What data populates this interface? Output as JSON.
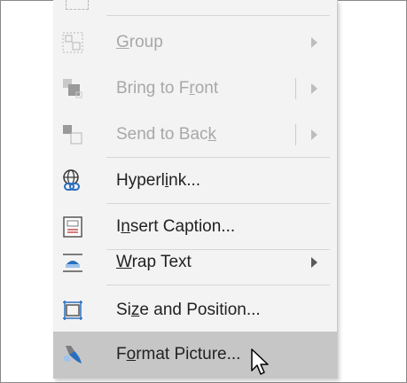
{
  "menu": {
    "items": [
      {
        "pre": "",
        "ul": "G",
        "post": "roup",
        "disabled": true,
        "submenu": true,
        "split": false,
        "icon": "group-icon"
      },
      {
        "pre": "Bring to F",
        "ul": "r",
        "post": "ont",
        "disabled": true,
        "submenu": true,
        "split": true,
        "icon": "bring-to-front-icon"
      },
      {
        "pre": "Send to Bac",
        "ul": "k",
        "post": "",
        "disabled": true,
        "submenu": true,
        "split": true,
        "icon": "send-to-back-icon"
      },
      {
        "pre": "Hyperl",
        "ul": "i",
        "post": "nk...",
        "disabled": false,
        "submenu": false,
        "split": false,
        "icon": "hyperlink-icon"
      },
      {
        "pre": "I",
        "ul": "n",
        "post": "sert Caption...",
        "disabled": false,
        "submenu": false,
        "split": false,
        "icon": "insert-caption-icon"
      },
      {
        "pre": "",
        "ul": "W",
        "post": "rap Text",
        "disabled": false,
        "submenu": true,
        "split": false,
        "icon": "wrap-text-icon"
      },
      {
        "pre": "Si",
        "ul": "z",
        "post": "e and Position...",
        "disabled": false,
        "submenu": false,
        "split": false,
        "icon": "size-and-position-icon"
      },
      {
        "pre": "F",
        "ul": "o",
        "post": "rmat Picture...",
        "disabled": false,
        "submenu": false,
        "split": false,
        "icon": "format-picture-icon",
        "highlighted": true
      }
    ]
  },
  "colors": {
    "menu_background": "#f3f3f3",
    "highlight": "#c6c6c6",
    "disabled_text": "#a8a8a8",
    "text": "#222222"
  }
}
